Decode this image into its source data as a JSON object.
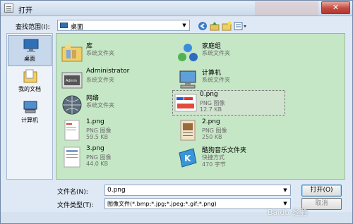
{
  "window": {
    "title": "打开",
    "close_glyph": "✕"
  },
  "toolbar": {
    "lookin_label": "查找范围(I):",
    "lookin_value": "桌面",
    "icons": [
      "back-arrow-icon",
      "up-folder-icon",
      "new-folder-icon",
      "view-menu-icon"
    ]
  },
  "places": [
    {
      "label": "桌面",
      "icon": "desktop-icon",
      "selected": true
    },
    {
      "label": "我的文档",
      "icon": "documents-icon",
      "selected": false
    },
    {
      "label": "计算机",
      "icon": "computer-icon",
      "selected": false
    }
  ],
  "files": [
    {
      "name": "库",
      "type": "系统文件夹",
      "size": "",
      "icon": "library-folder-icon"
    },
    {
      "name": "家庭组",
      "type": "系统文件夹",
      "size": "",
      "icon": "homegroup-icon"
    },
    {
      "name": "Administrator",
      "type": "系统文件夹",
      "size": "",
      "icon": "user-folder-icon"
    },
    {
      "name": "计算机",
      "type": "系统文件夹",
      "size": "",
      "icon": "computer-icon"
    },
    {
      "name": "网络",
      "type": "系统文件夹",
      "size": "",
      "icon": "network-globe-icon"
    },
    {
      "name": "0.png",
      "type": "PNG 图像",
      "size": "12.7 KB",
      "icon": "png-thumbnail-icon",
      "selected": true
    },
    {
      "name": "1.png",
      "type": "PNG 图像",
      "size": "59.5 KB",
      "icon": "png-thumbnail-icon"
    },
    {
      "name": "2.png",
      "type": "PNG 图像",
      "size": "250 KB",
      "icon": "png-thumbnail-icon"
    },
    {
      "name": "3.png",
      "type": "PNG 图像",
      "size": "44.0 KB",
      "icon": "png-thumbnail-icon"
    },
    {
      "name": "酷狗音乐文件夹",
      "type": "快捷方式",
      "size": "470 字节",
      "icon": "shortcut-icon"
    }
  ],
  "footer": {
    "filename_label": "文件名(N):",
    "filename_value": "0.png",
    "filetype_label": "文件类型(T):",
    "filetype_value": "图像文件(*.bmp;*.jpg;*.jpeg;*.gif;*.png)",
    "open_button": "打开(O)",
    "cancel_button": "取消"
  },
  "watermark": "Baidu 经验"
}
